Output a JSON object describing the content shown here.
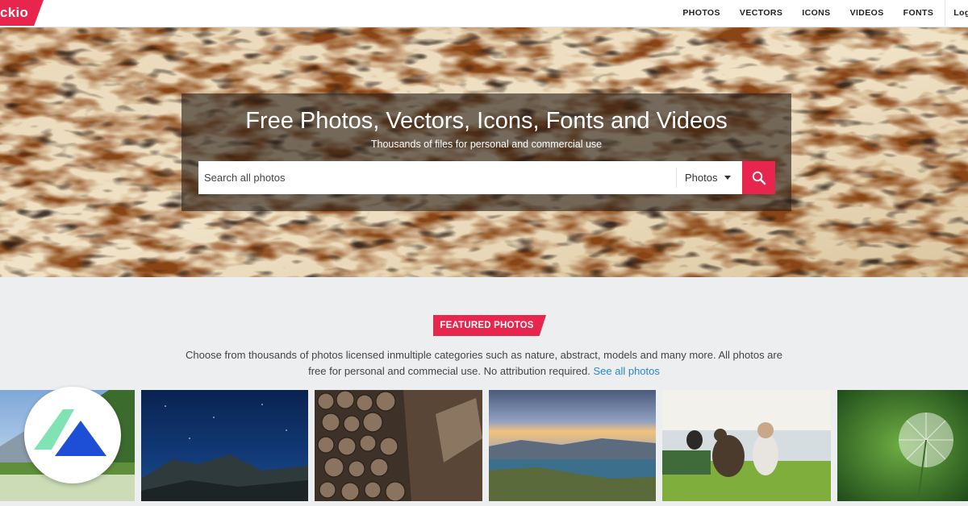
{
  "header": {
    "logo_text": "ckio",
    "nav": [
      "PHOTOS",
      "VECTORS",
      "ICONS",
      "VIDEOS",
      "FONTS"
    ],
    "login_label": "Logi"
  },
  "hero": {
    "title": "Free Photos, Vectors, Icons, Fonts and Videos",
    "subtitle": "Thousands of files for personal and commercial use",
    "search_placeholder": "Search all photos",
    "search_value": "",
    "category_selected": "Photos"
  },
  "featured": {
    "badge": "FEATURED PHOTOS",
    "description": "Choose from thousands of photos licensed inmultiple categories such as nature, abstract, models and many more. All photos are free for personal and commecial use. No attribution required.",
    "see_all_label": "See all photos",
    "thumbnails": [
      "mountain-meadow",
      "night-sky-mountain",
      "stacked-logs",
      "lake-sunset",
      "dog-and-girl-on-bench",
      "dandelion"
    ]
  },
  "colors": {
    "accent": "#e8254c",
    "link": "#2b86c8",
    "section_bg": "#eceef0"
  }
}
